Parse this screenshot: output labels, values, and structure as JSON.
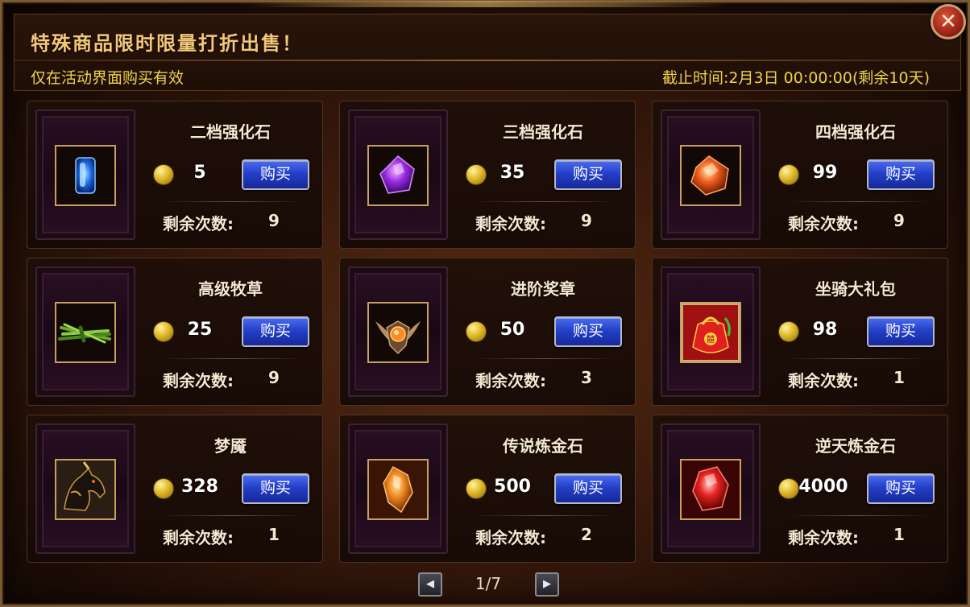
{
  "header": {
    "title": "特殊商品限时限量打折出售！",
    "subtitle": "仅在活动界面购买有效",
    "deadline": "截止时间:2月3日 00:00:00(剩余10天)"
  },
  "close_icon": "close-icon",
  "remain_label": "剩余次数:",
  "buy_label": "购买",
  "items": [
    {
      "name": "二档强化石",
      "price": "5",
      "remaining": "9",
      "icon": "blue-gem-icon"
    },
    {
      "name": "三档强化石",
      "price": "35",
      "remaining": "9",
      "icon": "purple-gem-icon"
    },
    {
      "name": "四档强化石",
      "price": "99",
      "remaining": "9",
      "icon": "orange-gem-icon"
    },
    {
      "name": "高级牧草",
      "price": "25",
      "remaining": "9",
      "icon": "grass-icon"
    },
    {
      "name": "进阶奖章",
      "price": "50",
      "remaining": "3",
      "icon": "medal-icon"
    },
    {
      "name": "坐骑大礼包",
      "price": "98",
      "remaining": "1",
      "icon": "gift-bag-icon"
    },
    {
      "name": "梦魇",
      "price": "328",
      "remaining": "1",
      "icon": "nightmare-mount-icon"
    },
    {
      "name": "传说炼金石",
      "price": "500",
      "remaining": "2",
      "icon": "legend-stone-icon"
    },
    {
      "name": "逆天炼金石",
      "price": "4000",
      "remaining": "1",
      "icon": "red-stone-icon"
    }
  ],
  "pagination": {
    "current": "1/7",
    "prev_icon": "prev-arrow-icon",
    "next_icon": "next-arrow-icon"
  },
  "colors": {
    "title": "#f4c878",
    "notice": "#f0d24a",
    "button": "#2440c8",
    "coin": "#e0b828"
  }
}
